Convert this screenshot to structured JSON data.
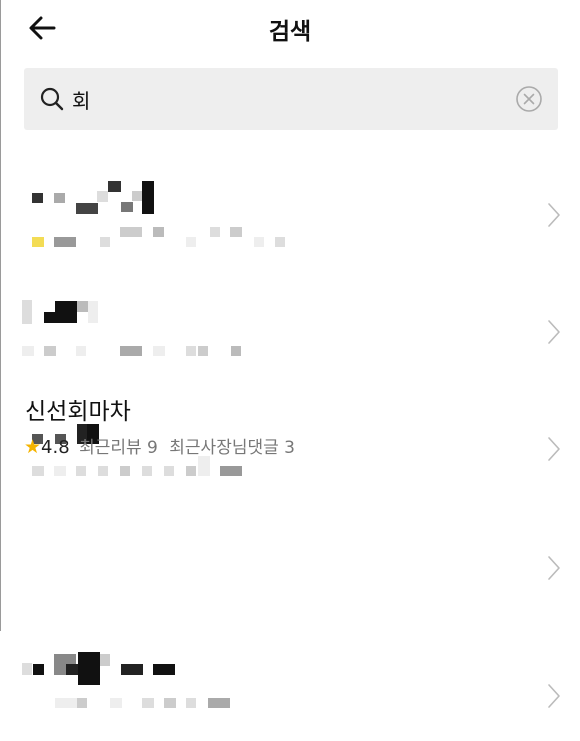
{
  "header": {
    "title": "검색"
  },
  "search": {
    "query": "회"
  },
  "results": [
    {
      "name": "",
      "meta": ""
    },
    {
      "name": "",
      "meta": ""
    },
    {
      "name": "",
      "meta": ""
    },
    {
      "name": "신선회마차",
      "rating": "4.8",
      "review_text": "최근리뷰 9",
      "reply_text": "최근사장님댓글 3"
    },
    {
      "name": "",
      "meta": ""
    }
  ],
  "colors": {
    "star": "#f5b400",
    "search_bg": "#eeeeee",
    "meta_text": "#777777"
  },
  "icons": [
    "back-arrow-icon",
    "search-icon",
    "clear-icon",
    "chevron-right-icon",
    "star-icon"
  ]
}
